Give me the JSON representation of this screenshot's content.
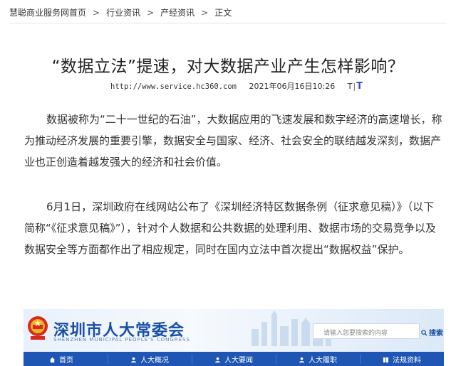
{
  "breadcrumb": {
    "items": [
      "慧聪商业服务网首页",
      "行业资讯",
      "产经资讯",
      "正文"
    ],
    "separator": ">"
  },
  "article": {
    "title": "“数据立法”提速，对大数据产业产生怎样影响？",
    "source_url": "http://www.service.hc360.com",
    "date": "2021年06月16日10:26",
    "font_small": "T",
    "font_sep": "|",
    "font_large": "T",
    "paragraphs": [
      "数据被称为“二十一世纪的石油”，大数据应用的飞速发展和数字经济的高速增长，称为推动经济发展的重要引擎，数据安全与国家、经济、社会安全的联结越发深刻，数据产业也正创造着越发强大的经济和社会价值。",
      "6月1日，深圳政府在线网站公布了《深圳经济特区数据条例（征求意见稿）》（以下简称“《征求意见稿》”），针对个人数据和公共数据的处理利用、数据市场的交易竞争以及数据安全等方面都作出了相应规定，同时在国内立法中首次提出“数据权益”保护。"
    ]
  },
  "banner": {
    "title": "深圳市人大常委会",
    "subtitle": "SHENZHEN MUNICIPAL PEOPLE'S CONGRESS",
    "search_placeholder": "请输入您要搜索的内容",
    "search_label": "搜索",
    "nav": [
      "首页",
      "人大概况",
      "人大要闻",
      "人大履职",
      "法规资料"
    ],
    "colors": {
      "brand": "#1a4fa6",
      "navbar": "#1f56b3",
      "accent_blue": "#2a54c8"
    }
  }
}
